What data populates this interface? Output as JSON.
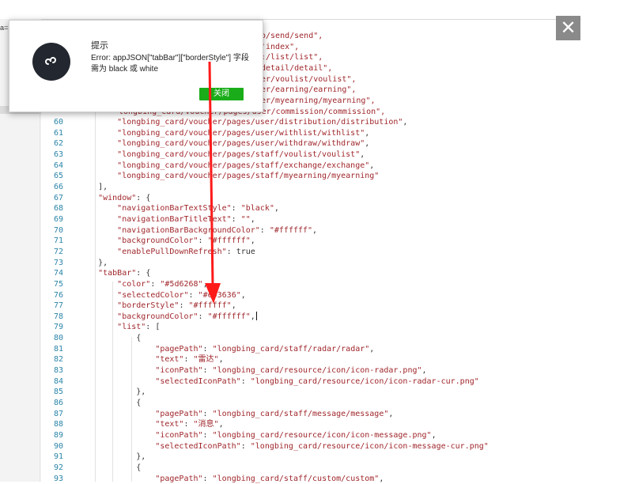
{
  "top_label": "a=",
  "close_glyph": "✕",
  "dialog": {
    "title": "提示",
    "message": "Error: appJSON[\"tabBar\"][\"borderStyle\"] 字段需为 black 或 white",
    "button": "关闭"
  },
  "colors": {
    "accent": "#1aad19",
    "arrow": "#ff1a1a",
    "string": "#a0272c",
    "line_number": "#2a84a8",
    "keyword": "#1a4bd6"
  },
  "top_fragments": [
    "o/send/send\",",
    "'index\",",
    ":/list/list\",",
    "detail/detail\",",
    "er/voulist/voulist\",",
    "er/earning/earning\",",
    "er/myearning/myearning\",",
    "longbing_card/voucher/pages/user/commission/commission\","
  ],
  "code_lines": [
    {
      "n": "60",
      "t": "        \"longbing_card/voucher/pages/user/distribution/distribution\","
    },
    {
      "n": "61",
      "t": "        \"longbing_card/voucher/pages/user/withlist/withlist\","
    },
    {
      "n": "62",
      "t": "        \"longbing_card/voucher/pages/user/withdraw/withdraw\","
    },
    {
      "n": "63",
      "t": "        \"longbing_card/voucher/pages/staff/voulist/voulist\","
    },
    {
      "n": "64",
      "t": "        \"longbing_card/voucher/pages/staff/exchange/exchange\","
    },
    {
      "n": "65",
      "t": "        \"longbing_card/voucher/pages/staff/myearning/myearning\""
    },
    {
      "n": "66",
      "t": "    ],"
    },
    {
      "n": "67",
      "t": "    \"window\": {"
    },
    {
      "n": "68",
      "t": "        \"navigationBarTextStyle\": \"black\","
    },
    {
      "n": "69",
      "t": "        \"navigationBarTitleText\": \"\","
    },
    {
      "n": "70",
      "t": "        \"navigationBarBackgroundColor\": \"#ffffff\","
    },
    {
      "n": "71",
      "t": "        \"backgroundColor\": \"#ffffff\","
    },
    {
      "n": "72",
      "t": "        \"enablePullDownRefresh\": true"
    },
    {
      "n": "73",
      "t": "    },"
    },
    {
      "n": "74",
      "t": "    \"tabBar\": {"
    },
    {
      "n": "75",
      "t": "        \"color\": \"#5d6268\","
    },
    {
      "n": "76",
      "t": "        \"selectedColor\": \"#e93636\","
    },
    {
      "n": "77",
      "t": "        \"borderStyle\": \"#ffffff\","
    },
    {
      "n": "78",
      "t": "        \"backgroundColor\": \"#ffffff\","
    },
    {
      "n": "79",
      "t": "        \"list\": ["
    },
    {
      "n": "80",
      "t": "            {"
    },
    {
      "n": "81",
      "t": "                \"pagePath\": \"longbing_card/staff/radar/radar\","
    },
    {
      "n": "82",
      "t": "                \"text\": \"雷达\","
    },
    {
      "n": "83",
      "t": "                \"iconPath\": \"longbing_card/resource/icon/icon-radar.png\","
    },
    {
      "n": "84",
      "t": "                \"selectedIconPath\": \"longbing_card/resource/icon/icon-radar-cur.png\""
    },
    {
      "n": "85",
      "t": "            },"
    },
    {
      "n": "86",
      "t": "            {"
    },
    {
      "n": "87",
      "t": "                \"pagePath\": \"longbing_card/staff/message/message\","
    },
    {
      "n": "88",
      "t": "                \"text\": \"消息\","
    },
    {
      "n": "89",
      "t": "                \"iconPath\": \"longbing_card/resource/icon/icon-message.png\","
    },
    {
      "n": "90",
      "t": "                \"selectedIconPath\": \"longbing_card/resource/icon/icon-message-cur.png\""
    },
    {
      "n": "91",
      "t": "            },"
    },
    {
      "n": "92",
      "t": "            {"
    },
    {
      "n": "93",
      "t": "                \"pagePath\": \"longbing_card/staff/custom/custom\","
    }
  ]
}
